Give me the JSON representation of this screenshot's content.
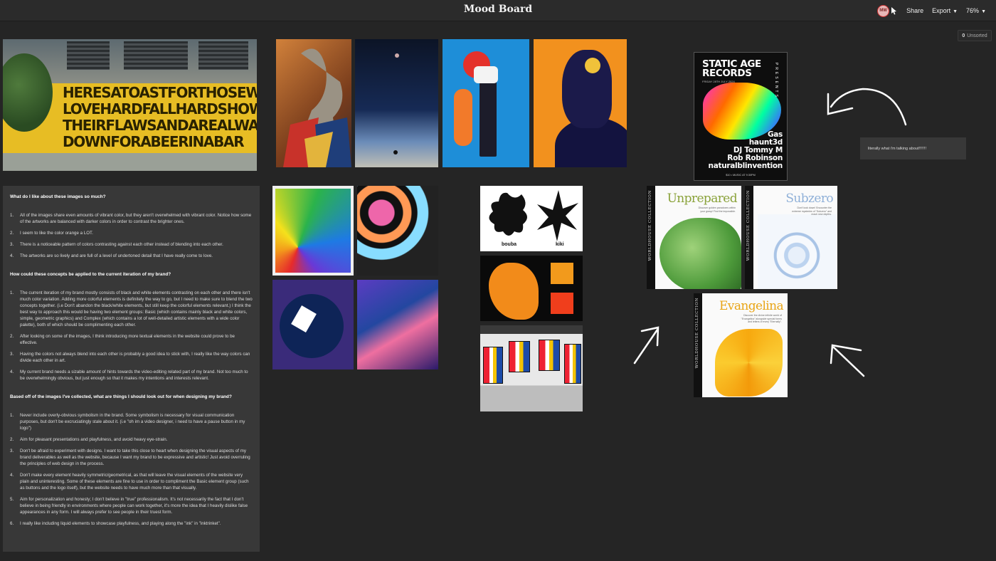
{
  "header": {
    "title": "Mood Board",
    "avatar_initials": "MW",
    "share_label": "Share",
    "export_label": "Export",
    "zoom": "76%"
  },
  "unsorted": {
    "count": "0",
    "label": "Unsorted"
  },
  "mural": {
    "lines": [
      "HERESATOASTFORTHOSEWHO",
      "LOVEHARDFALLHARDSHOW",
      "THEIRFLAWSANDAREALWAYS",
      "DOWNFORABEERINABAR"
    ]
  },
  "notes": {
    "sections": [
      {
        "heading": "What do I like about these images so much?",
        "items": [
          "All of the images share even amounts of vibrant color, but they aren't overwhelmed with vibrant color. Notice how some of the artworks are balanced with darker colors in order to contrast the brighter ones.",
          "I seem to like the color orange a LOT.",
          "There is a noticeable pattern of colors contrasting against each other instead of blending into each other.",
          "The artworks are so lively and are full of a level of undertoned detail that I have really come to love."
        ]
      },
      {
        "heading": "How could these concepts be applied to the current iteration of my brand?",
        "items": [
          "The current iteration of my brand mostly consists of black and white elements contrasting on each other and there isn't much color variation. Adding more colorful elements is definitely the way to go, but I need to make sure to blend the two concepts together. (i.e Don't abandon the black/white elements, but still keep the colorful elements relevant.) I think the best way to approach this would be having two element groups: Basic (which contains mainly black and white colors, simple, geometric graphics) and Complex (which contains a lot of well-detailed artistic elements with a wide color palette), both of which should be complimenting each other.",
          "After looking on some of the images, I think introducing more textual elements in the website could prove to be effective.",
          "Having the colors not always blend into each other is probably a good idea to stick with, I really like the way colors can divide each other in art.",
          "My current brand needs a sizable amount of hints towards the video-editing related part of my brand. Not too much to be overwhelmingly obvious, but just enough so that it makes my intentions and interests relevant."
        ]
      },
      {
        "heading": "Based off of the images I've collected, what are things I should look out for when designing my brand?",
        "items": [
          "Never include overly-obvious symbolism in the brand. Some symbolism is necessary for visual communication purposes, but don't be excruciatingly stale about it. (i.e \"oh im a video designer, i need to have a pause button in my logo\")",
          "Aim for pleasant presentations and playfulness, and avoid heavy eye-strain.",
          "Don't be afraid to experiment with designs. I want to take this close to heart when designing the visual aspects of my brand deliverables as well as the website, because I want my brand to be expressive and artistic! Just avoid overruling the principles of web design in the process.",
          "Don't make every element heavily symmetric/geometrical, as that will leave the visual elements of the website very plain and uninteresting. Some of these elements are fine to use in order to compliment the Basic element group (such as buttons and the logo itself), but the website needs to have much more than that visually.",
          "Aim for personalization and honesty; I don't believe in \"true\" professionalism. It's not necessarily the fact that I don't believe in being friendly in environments where people can work together, it's more the idea that I heavily dislike false appearances in any form. I will always prefer to see people in their truest form.",
          "I really like including liquid elements to showcase playfulness, and playing along the \"ink\" in \"inktrinket\"."
        ]
      }
    ]
  },
  "poster": {
    "head_line1": "STATIC AGE",
    "head_line2": "RECORDS",
    "date": "FRIDAY 28TH JULY 2024",
    "presents": "PRESENTS",
    "lineup": [
      "Gas",
      "haunt3d",
      "DJ Tommy M",
      "Rob Robinson",
      "naturalblinvention"
    ],
    "footer": "$10 • MUSIC AT 9:30PM"
  },
  "comment": {
    "text": "literally what i'm talking about!!!!!!!"
  },
  "boubakiki": {
    "left": "bouba",
    "right": "kiki"
  },
  "books": {
    "spine": "WORLDHOUSE COLLECTION",
    "unprepared": {
      "title": "Unprepared",
      "sub": "Discover golden paradoxes within your grasp! Find the impossible."
    },
    "subzero": {
      "title": "Subzero",
      "sub": "Don't look down! Encounter the extreme mysteries of \"Subzero\" and reach new depths."
    },
    "evangelina": {
      "title": "Evangelina",
      "sub": "Discover the divine infinite world of \"Evangelina\" alongside special forms and letters of every \"Eternally\"."
    }
  },
  "colors": {
    "background": "#252525",
    "panel": "#383838",
    "topbar": "#2b2b2b"
  }
}
